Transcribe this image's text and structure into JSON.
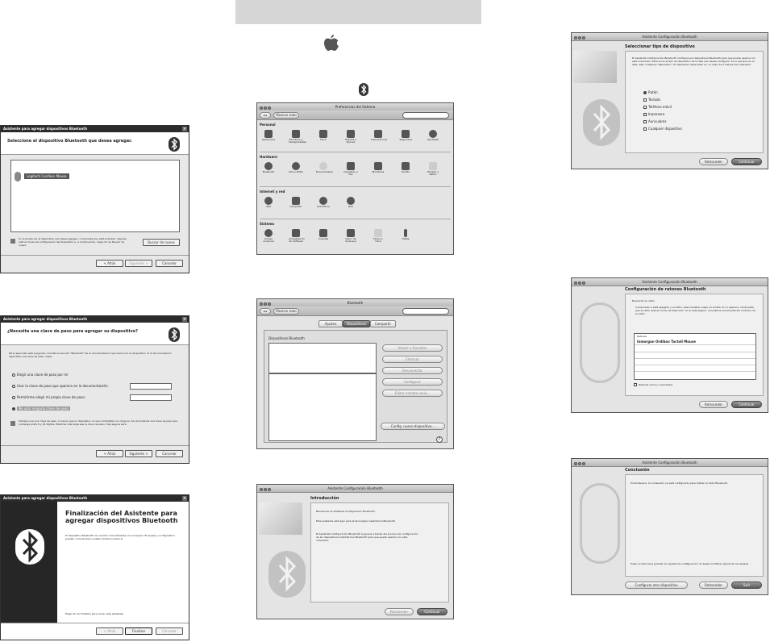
{
  "win1": {
    "title": "Asistente para agregar dispositivos Bluetooth",
    "header": "Seleccione el dispositivo Bluetooth que desea agregar.",
    "device": "Logitech Cordless Mouse",
    "note": "Si no puede ver el dispositivo que desea agregar, compruebe que está activado. Siga las instrucciones de configuración del dispositivo y, a continuación, haga clic en Buscar de nuevo.",
    "search_again": "Buscar de nuevo",
    "back": "< Atrás",
    "next": "Siguiente >",
    "cancel": "Cancelar"
  },
  "win2": {
    "title": "Asistente para agregar dispositivos Bluetooth",
    "header": "¿Necesita una clave de paso para agregar su dispositivo?",
    "intro": "Para responder esta pregunta, consulte la sección \"Bluetooth\" de la documentación que viene con su dispositivo. Si la documentación especifica una clave de paso, úsela.",
    "opt1": "Elegir una clave de paso por mí",
    "opt2": "Usar la clave de paso que aparece en la documentación:",
    "opt3": "Permitirme elegir mi propia clave de paso:",
    "opt4": "No usar ninguna clave de paso",
    "warning": "Siempre use una clave de paso, a menos que su dispositivo no sea compatible con ninguna. Se recomienda una clave de paso que contenga entre 8 y 16 dígitos. Mientras más larga sea la clave de paso, más segura será.",
    "back": "< Atrás",
    "next": "Siguiente >",
    "cancel": "Cancelar"
  },
  "win3": {
    "title": "Asistente para agregar dispositivos Bluetooth",
    "heading": "Finalización del Asistente para agregar dispositivos Bluetooth",
    "body": "El dispositivo Bluetooth se conectó correctamente con el equipo. El equipo y el dispositivo pueden comunicarse si están próximos entre sí.",
    "footer": "Haga clic en Finalizar para cerrar este asistente.",
    "back": "< Atrás",
    "finish": "Finalizar",
    "cancel": "Cancelar"
  },
  "prefs": {
    "title": "Preferencias del Sistema",
    "show_all": "Mostrar todo",
    "sections": [
      "Personal",
      "Hardware",
      "Internet y red",
      "Sistema"
    ],
    "personal": [
      "Apariencia",
      "Escritorio y Salvapantallas",
      "Dock",
      "Exposé y Spaces",
      "Internacional",
      "Seguridad",
      "Spotlight"
    ],
    "hardware": [
      "Bluetooth",
      "CDs y DVDs",
      "Economizador",
      "Impresión y Fax",
      "Monitores",
      "Sonido",
      "Teclado y Ratón"
    ],
    "internet": [
      ".Mac",
      "Compartir",
      "QuickTime",
      "Red"
    ],
    "system": [
      "Acceso universal",
      "Actualización de Software",
      "Cuentas",
      "Disco de Arranque",
      "Fecha y Hora",
      "Habla"
    ]
  },
  "btpref": {
    "title": "Bluetooth",
    "show_all": "Mostrar todo",
    "tabs": [
      "Ajustes",
      "Dispositivos",
      "Compartir"
    ],
    "list_header": "Dispositivos Bluetooth",
    "actions": [
      "Añadir a Favoritos",
      "Eliminar",
      "Desconectar",
      "Configurar",
      "Editar nombre serie..."
    ],
    "setup_new": "Config. nuevo dispositivo..."
  },
  "intro": {
    "title": "Asistente Configuración Bluetooth",
    "heading": "Introducción",
    "p1": "Bienvenido al Asistente Configuración Bluetooth.",
    "p2": "Este asistente está aquí para la tecnología inalámbrica Bluetooth.",
    "p3": "El Asistente Configuración Bluetooth le guiará a través del proceso de configuración de los dispositivos inalámbricos Bluetooth para que pueda usarlos con este ordenador.",
    "back": "Retroceder",
    "continue": "Continuar"
  },
  "type": {
    "title": "Asistente Configuración Bluetooth",
    "heading": "Seleccionar tipo de dispositivo",
    "desc": "El Asistente Configuración Bluetooth configura sus dispositivos Bluetooth para que pueda usarlos con este ordenador. Seleccione el tipo de dispositivo de la lista que desea configurar. Si no aparece en la lista, elija \"Cualquier dispositivo\". El dispositivo debe estar en un radio de 9 metros del ordenador.",
    "options": [
      "Ratón",
      "Teclado",
      "Teléfono móvil",
      "Impresora",
      "Auriculares",
      "Cualquier dispositivo"
    ],
    "back": "Retroceder",
    "continue": "Continuar"
  },
  "mouse": {
    "title": "Asistente Configuración Bluetooth",
    "heading": "Configuración de ratones Bluetooth",
    "sub": "Buscando su ratón",
    "desc": "Compruebe si está apagado y el ratón, seleccionable, luego en la lista. Si no aparece, compruebe que el ratón esté en modo de detección. Si no está seguro, consulte la documentación incluida con el ratón.",
    "col": "Ratones",
    "device": "Inmorgan Ordibox Tactoll Mouse",
    "checkbox": "Ratones cerca y conectados",
    "back": "Retroceder",
    "continue": "Continuar"
  },
  "conclusion": {
    "title": "Asistente Configuración Bluetooth",
    "heading": "Conclusión",
    "p1": "Enhorabuena. Su ordenador ya está configurado para utilizar el ratón Bluetooth.",
    "p2": "Pulse en Salir para guardar los ajustes de configuración. Si desea modificar alguna de los ajustes.",
    "btn1": "Configurar otro dispositivo",
    "back": "Retroceder",
    "quit": "Salir"
  }
}
